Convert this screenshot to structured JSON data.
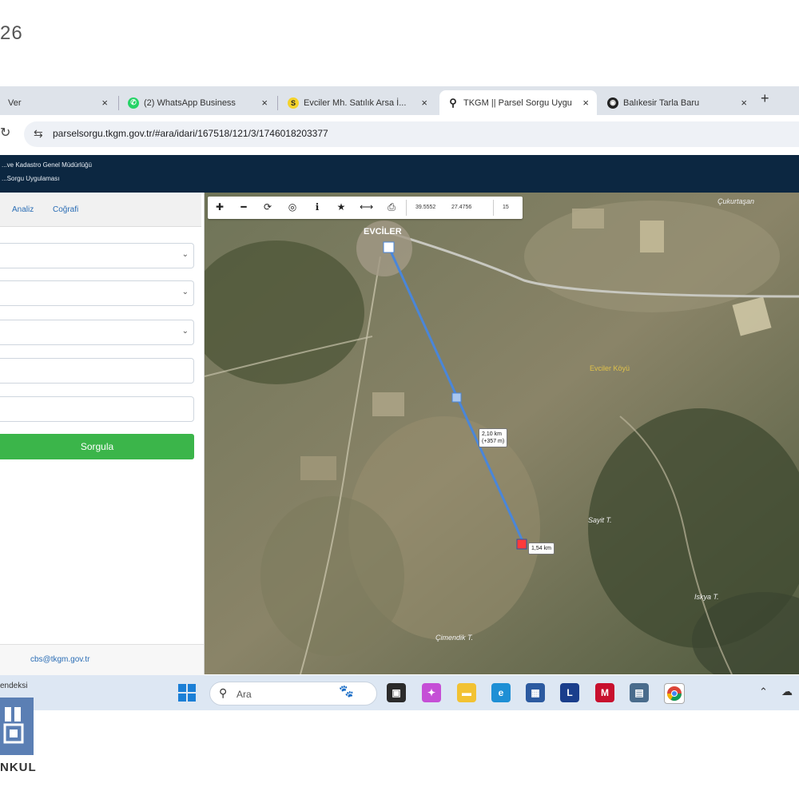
{
  "corner_text": "26",
  "tabs": [
    {
      "label": "Ver",
      "active": false
    },
    {
      "label": "(2) WhatsApp Business",
      "active": false
    },
    {
      "label": "Evciler Mh. Satılık Arsa İ...",
      "active": false
    },
    {
      "label": "TKGM || Parsel Sorgu Uygu",
      "active": true
    },
    {
      "label": "Balıkesir Tarla Baru",
      "active": false
    }
  ],
  "tab_close": "×",
  "new_tab": "+",
  "address": {
    "url": "parselsorgu.tkgm.gov.tr/#ara/idari/167518/121/3/1746018203377"
  },
  "site_header": {
    "org_name": "...ve Kadastro Genel Müdürlüğü",
    "app_name": "...Sorgu Uygulaması"
  },
  "left_panel": {
    "tabs": [
      "Analiz",
      "Coğrafi"
    ],
    "submit_label": "Sorgula",
    "email": "cbs@tkgm.gov.tr"
  },
  "map": {
    "toolbar": {
      "coord_lat": "39.5552",
      "coord_lon": "27.4756",
      "zoom": "15"
    },
    "labels": {
      "village_name": "EVCİLER",
      "place_top_right": "Çukurtaşan",
      "place_yellow": "Evciler Köyü",
      "place_right": "Sayit T.",
      "place_bottom_right": "Iskya T.",
      "place_bottom": "Çimendik T."
    },
    "measure": {
      "segment_distance": "2,10 km",
      "segment_extra": "(+357 m)",
      "end_distance": "1,54 km"
    }
  },
  "taskbar": {
    "left_text": "endeksi",
    "search_placeholder": "Ara"
  },
  "logo_text": "NKUL"
}
